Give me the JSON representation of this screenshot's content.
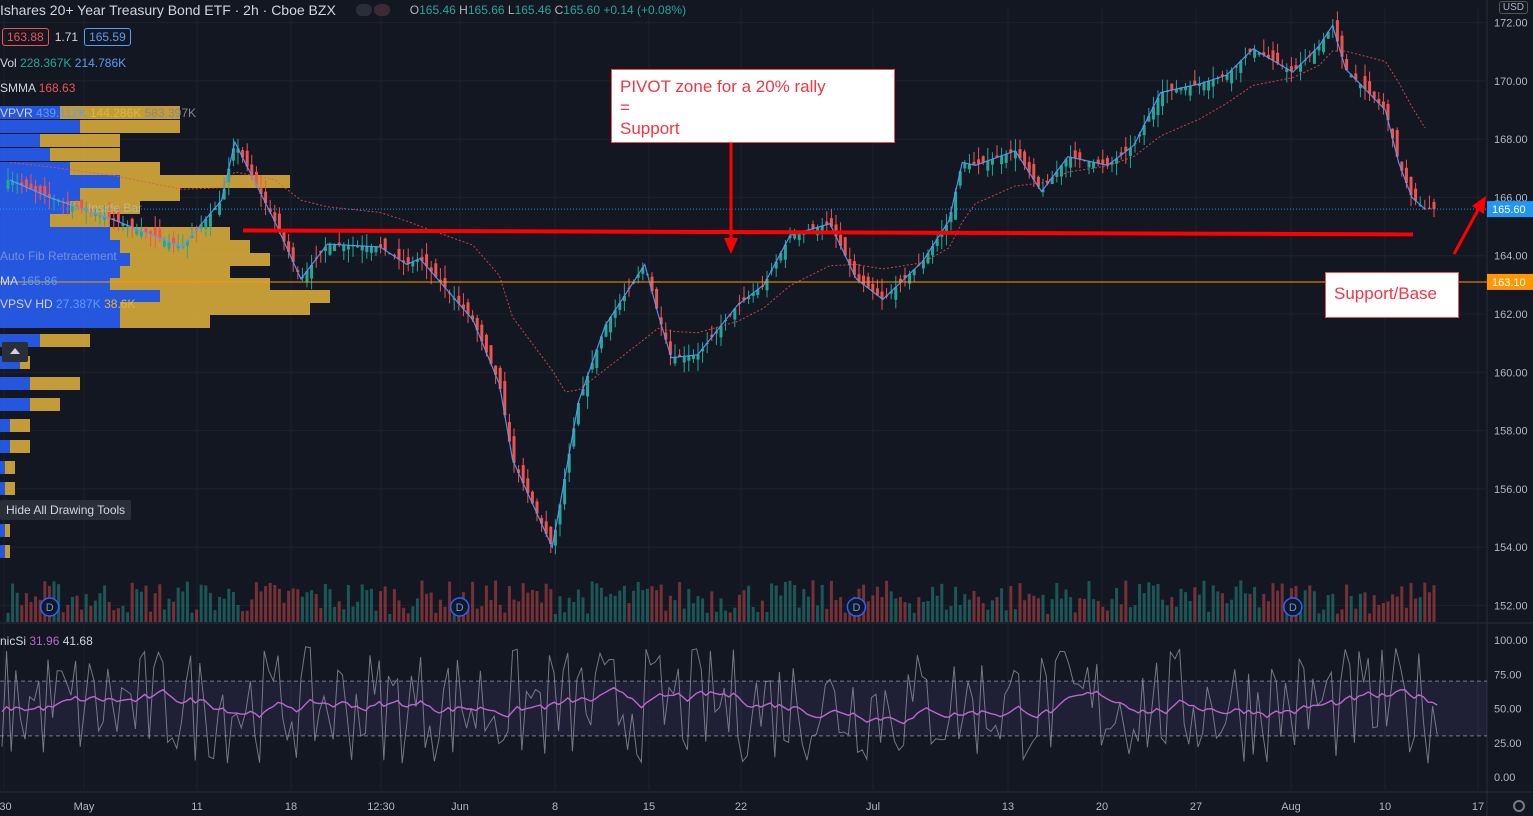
{
  "header": {
    "title": "Ishares 20+ Year Treasury Bond ETF · 2h · Cboe BZX",
    "open": "165.46",
    "high": "165.66",
    "low": "165.46",
    "close": "165.60",
    "change": "+0.14 (+0.08%)",
    "o_label": "O",
    "h_label": "H",
    "l_label": "L",
    "c_label": "C"
  },
  "quote": {
    "bid": "163.88",
    "spread": "1.71",
    "ask": "165.59"
  },
  "currency": "USD",
  "legends": [
    {
      "label": "Vol",
      "v1": "228.367K",
      "v2": "214.786K",
      "c1": "#26a69a",
      "c2": "#5b9cf6",
      "dim": false
    },
    {
      "label": "SMMA",
      "v1": "168.63",
      "v2": "",
      "c1": "#ef5350",
      "c2": "",
      "dim": false
    },
    {
      "label": "VPVR",
      "v1": "439.112K",
      "v2": "144.286K",
      "v3": "583.397K",
      "c1": "#5b9cf6",
      "c2": "#e2b43d",
      "dim": false
    },
    {
      "label": "MA",
      "v1": "165.86",
      "v2": "",
      "c1": "#5b9cf6",
      "c2": "",
      "dim": false
    },
    {
      "label": "VPSV HD",
      "v1": "27.387K",
      "v2": "38.6K",
      "c1": "#5b9cf6",
      "c2": "#e2b43d",
      "dim": false
    }
  ],
  "dim_legends": [
    "Auto Fib Retracement",
    "Inside Bar"
  ],
  "toolbar": {
    "hide_tools": "Hide All Drawing Tools"
  },
  "rsi": {
    "label": "nicSi",
    "v1": "31.96",
    "v2": "41.68"
  },
  "annotations": {
    "pivot_lines": [
      "PIVOT zone for a 20% rally",
      "=",
      "Support"
    ],
    "support_base": "Support/Base"
  },
  "colors": {
    "up": "#26a69a",
    "down": "#ef5350",
    "support_line": "#ff0000",
    "ma": "#5b9cf6",
    "smma": "#ef5350",
    "bg": "#131722",
    "vp_blue": "#2962ff",
    "vp_gold": "#e2b43d"
  },
  "chart_data": {
    "type": "candlestick",
    "title": "Ishares 20+ Year Treasury Bond ETF",
    "ylim": [
      151.5,
      172.5
    ],
    "price_ticks": [
      "172.00",
      "170.00",
      "168.00",
      "166.00",
      "164.00",
      "162.00",
      "160.00",
      "158.00",
      "156.00",
      "154.00",
      "152.00"
    ],
    "x_ticks": [
      ":30",
      "May",
      "11",
      "18",
      "12:30",
      "Jun",
      "8",
      "15",
      "22",
      "Jul",
      "13",
      "20",
      "27",
      "Aug",
      "10",
      "17"
    ],
    "price_labels": [
      {
        "value": 165.6,
        "text": "165.60",
        "color": "#2196f3"
      },
      {
        "value": 163.1,
        "text": "163.10",
        "color": "#ff9800"
      }
    ],
    "support_level": 164.8,
    "close_path": [
      [
        "Apr 28",
        166.6
      ],
      [
        "May 1",
        166.0
      ],
      [
        "May 6",
        165.2
      ],
      [
        "May 11",
        164.3
      ],
      [
        "May 14",
        165.9
      ],
      [
        "May 15",
        167.9
      ],
      [
        "May 18",
        165.2
      ],
      [
        "May 20",
        163.2
      ],
      [
        "May 22",
        164.4
      ],
      [
        "May 26",
        164.3
      ],
      [
        "May 28",
        163.7
      ],
      [
        "May 29",
        163.9
      ],
      [
        "Jun 2",
        161.8
      ],
      [
        "Jun 4",
        159.6
      ],
      [
        "Jun 5",
        157.0
      ],
      [
        "Jun 8",
        154.0
      ],
      [
        "Jun 9",
        156.5
      ],
      [
        "Jun 10",
        159.0
      ],
      [
        "Jun 12",
        161.6
      ],
      [
        "Jun 15",
        163.7
      ],
      [
        "Jun 16",
        162.0
      ],
      [
        "Jun 17",
        160.5
      ],
      [
        "Jun 19",
        160.6
      ],
      [
        "Jun 22",
        162.3
      ],
      [
        "Jun 24",
        163.0
      ],
      [
        "Jun 26",
        164.7
      ],
      [
        "Jun 29",
        165.1
      ],
      [
        "Jul 1",
        163.2
      ],
      [
        "Jul 3",
        162.5
      ],
      [
        "Jul 6",
        163.8
      ],
      [
        "Jul 8",
        165.2
      ],
      [
        "Jul 9",
        167.2
      ],
      [
        "Jul 10",
        167.1
      ],
      [
        "Jul 13",
        167.6
      ],
      [
        "Jul 15",
        166.2
      ],
      [
        "Jul 17",
        167.4
      ],
      [
        "Jul 20",
        167.1
      ],
      [
        "Jul 22",
        167.8
      ],
      [
        "Jul 24",
        169.6
      ],
      [
        "Jul 27",
        169.9
      ],
      [
        "Jul 29",
        170.2
      ],
      [
        "Jul 31",
        171.1
      ],
      [
        "Aug 3",
        170.3
      ],
      [
        "Aug 5",
        171.2
      ],
      [
        "Aug 6",
        171.9
      ],
      [
        "Aug 7",
        170.4
      ],
      [
        "Aug 10",
        169.0
      ],
      [
        "Aug 11",
        167.2
      ],
      [
        "Aug 12",
        166.0
      ],
      [
        "Aug 13",
        165.6
      ]
    ],
    "rsi_ticks": [
      "100.00",
      "75.00",
      "50.00",
      "25.00",
      "0.00"
    ],
    "rsi_bands": [
      30,
      70
    ],
    "dividend_markers": [
      "May 1",
      "Jun 1",
      "Jul 1",
      "Aug 3"
    ],
    "dividend_label": "D"
  }
}
